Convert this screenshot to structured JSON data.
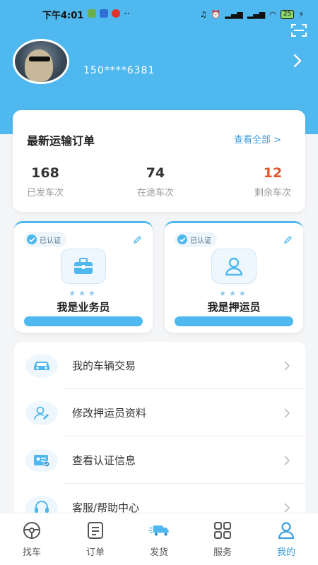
{
  "status_bar": {
    "time": "下午4:01",
    "battery": "25"
  },
  "profile": {
    "phone": "150****6381"
  },
  "orders": {
    "title": "最新运输订单",
    "view_all": "查看全部 >",
    "stats": [
      {
        "value": "168",
        "label": "已发车次"
      },
      {
        "value": "74",
        "label": "在途车次"
      },
      {
        "value": "12",
        "label": "剩余车次"
      }
    ]
  },
  "roles": [
    {
      "badge": "已认证",
      "name": "我是业务员",
      "stars": "★★★",
      "icon": "briefcase-icon"
    },
    {
      "badge": "已认证",
      "name": "我是押运员",
      "stars": "★★★",
      "icon": "user-icon"
    }
  ],
  "menu": [
    {
      "label": "我的车辆交易",
      "icon": "car-icon"
    },
    {
      "label": "修改押运员资料",
      "icon": "user-edit-icon"
    },
    {
      "label": "查看认证信息",
      "icon": "id-card-icon"
    },
    {
      "label": "客服/帮助中心",
      "icon": "headset-icon"
    }
  ],
  "tabs": [
    {
      "label": "找车",
      "icon": "steering-wheel-icon"
    },
    {
      "label": "订单",
      "icon": "document-icon"
    },
    {
      "label": "发货",
      "icon": "truck-icon"
    },
    {
      "label": "服务",
      "icon": "grid-icon"
    },
    {
      "label": "我的",
      "icon": "profile-icon",
      "active": true
    }
  ],
  "colors": {
    "primary": "#4fb8ee",
    "accent_link": "#3c9ee0",
    "remaining": "#e2572b"
  }
}
